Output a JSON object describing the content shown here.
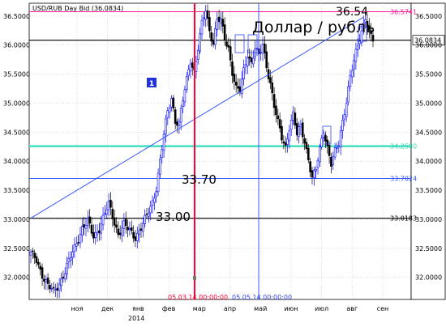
{
  "header": {
    "instrument_label": "USD/RUB Day Bid (36.0834)"
  },
  "annotations": {
    "main_title": "Доллар / рубль",
    "high_label": "36.54",
    "mid_label": "33.70",
    "low_label": "33.00",
    "trendline_badge": "1",
    "vline1_label": "05.03.14 00:00:00",
    "vline2_label": "05.05.14 00:00:00"
  },
  "colors": {
    "candle_up": "#0000ff",
    "candle_down": "#000000",
    "magenta_line": "#ff1493",
    "teal_line": "#40e0c0",
    "blue_line": "#3355ff",
    "black_line": "#000000",
    "red_vline": "#ff0033",
    "blue_vline": "#4455ff"
  },
  "chart_data": {
    "type": "candlestick",
    "yticks": [
      "36.5000",
      "36.0000",
      "35.5000",
      "35.0000",
      "34.5000",
      "34.0000",
      "33.5000",
      "33.0000",
      "32.5000",
      "32.0000"
    ],
    "ytick_values": [
      36.5,
      36.0,
      35.5,
      35.0,
      34.5,
      34.0,
      33.5,
      33.0,
      32.5,
      32.0
    ],
    "ylim": [
      31.62,
      36.72
    ],
    "xticks": [
      "ноя",
      "дек",
      "янв",
      "фев",
      "мар",
      "апр",
      "май",
      "июн",
      "июл",
      "авг",
      "сен"
    ],
    "xtick_year": "2014",
    "horizontal_lines": [
      {
        "value": 36.5741,
        "label": "36.5741",
        "color_key": "magenta_line"
      },
      {
        "value": 36.0834,
        "label": "36.0834",
        "color_key": "black_line",
        "boxed": true
      },
      {
        "value": 34.258,
        "label": "34.2580",
        "color_key": "teal_line"
      },
      {
        "value": 33.7024,
        "label": "33.7024",
        "color_key": "blue_line"
      },
      {
        "value": 33.0183,
        "label": "33.0183",
        "color_key": "black_line"
      }
    ],
    "anchors": [
      [
        0,
        32.4
      ],
      [
        3,
        32.3
      ],
      [
        6,
        32.05
      ],
      [
        9,
        31.85
      ],
      [
        12,
        31.75
      ],
      [
        15,
        31.9
      ],
      [
        18,
        32.1
      ],
      [
        21,
        32.35
      ],
      [
        24,
        32.6
      ],
      [
        27,
        32.85
      ],
      [
        30,
        32.95
      ],
      [
        33,
        32.7
      ],
      [
        36,
        32.85
      ],
      [
        39,
        33.1
      ],
      [
        41,
        33.25
      ],
      [
        43,
        33.05
      ],
      [
        46,
        32.75
      ],
      [
        49,
        32.9
      ],
      [
        52,
        32.8
      ],
      [
        55,
        32.7
      ],
      [
        58,
        32.85
      ],
      [
        61,
        33.05
      ],
      [
        64,
        33.3
      ],
      [
        66,
        33.55
      ],
      [
        68,
        34.0
      ],
      [
        70,
        34.45
      ],
      [
        72,
        34.85
      ],
      [
        74,
        35.1
      ],
      [
        76,
        34.7
      ],
      [
        78,
        34.65
      ],
      [
        80,
        35.05
      ],
      [
        82,
        35.4
      ],
      [
        84,
        35.75
      ],
      [
        86,
        35.55
      ],
      [
        88,
        35.95
      ],
      [
        90,
        36.35
      ],
      [
        92,
        36.6
      ],
      [
        94,
        36.25
      ],
      [
        96,
        36.05
      ],
      [
        98,
        36.45
      ],
      [
        100,
        36.4
      ],
      [
        102,
        36.1
      ],
      [
        104,
        35.95
      ],
      [
        106,
        35.55
      ],
      [
        108,
        35.25
      ],
      [
        110,
        35.2
      ],
      [
        112,
        35.55
      ],
      [
        114,
        35.85
      ],
      [
        116,
        35.7
      ],
      [
        118,
        35.95
      ],
      [
        120,
        35.8
      ],
      [
        122,
        36.0
      ],
      [
        124,
        35.65
      ],
      [
        126,
        35.35
      ],
      [
        128,
        34.95
      ],
      [
        130,
        34.65
      ],
      [
        132,
        34.4
      ],
      [
        134,
        34.25
      ],
      [
        136,
        34.6
      ],
      [
        138,
        34.8
      ],
      [
        140,
        34.45
      ],
      [
        142,
        34.6
      ],
      [
        144,
        34.35
      ],
      [
        146,
        34.05
      ],
      [
        148,
        33.7
      ],
      [
        150,
        33.85
      ],
      [
        152,
        34.2
      ],
      [
        154,
        34.55
      ],
      [
        156,
        34.25
      ],
      [
        158,
        33.95
      ],
      [
        160,
        34.15
      ],
      [
        162,
        34.3
      ],
      [
        164,
        34.7
      ],
      [
        166,
        35.05
      ],
      [
        168,
        35.45
      ],
      [
        170,
        35.7
      ],
      [
        172,
        36.0
      ],
      [
        174,
        36.25
      ],
      [
        176,
        36.5
      ],
      [
        178,
        36.2
      ],
      [
        180,
        36.08
      ]
    ],
    "date_at_index": {
      "0": "ноя-2013",
      "72": "05.03.14",
      "113": "05.05.14",
      "180": "авг-2014"
    },
    "trendline": {
      "from": [
        0,
        33.02
      ],
      "to": [
        175,
        36.48
      ]
    }
  }
}
